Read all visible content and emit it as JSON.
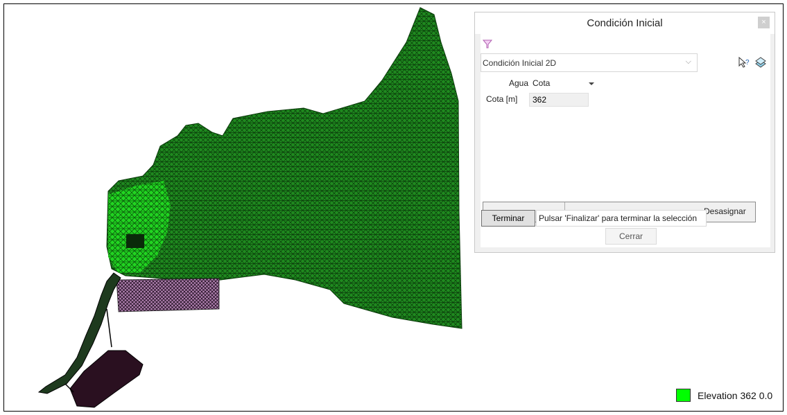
{
  "dialog": {
    "title": "Condición Inicial",
    "close_label": "×",
    "condition_dropdown": {
      "value": "Condición Inicial 2D",
      "chevron": "⌵"
    },
    "agua": {
      "label": "Agua",
      "value": "Cota"
    },
    "cota": {
      "label": "Cota [m]",
      "value": "362"
    },
    "desasignar_label": "Desasignar",
    "terminar_label": "Terminar",
    "tooltip_text": "Pulsar 'Finalizar' para terminar la selección",
    "cerrar_label": "Cerrar"
  },
  "legend": {
    "color": "#00ff00",
    "label": "Elevation 362 0.0"
  },
  "mesh": {
    "main_color": "#1a7a1a",
    "bright_color": "#18e018",
    "pink_color": "#d8a0d8"
  }
}
